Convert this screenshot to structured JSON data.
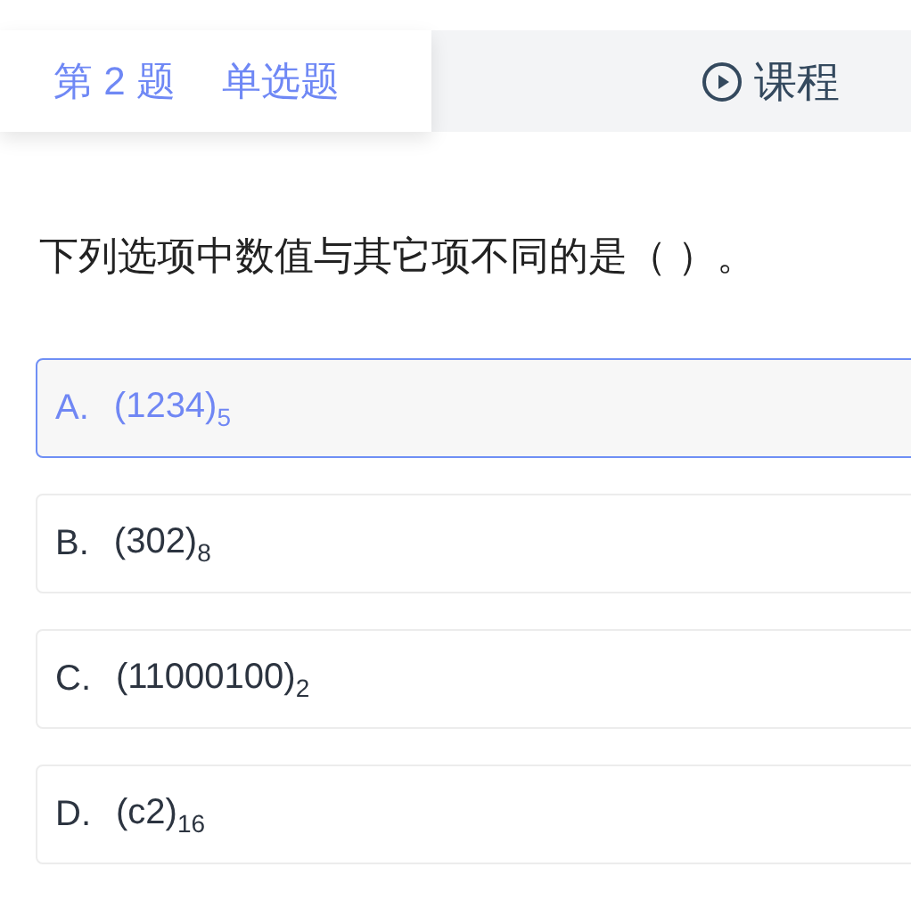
{
  "header": {
    "question_number": "第 2 题",
    "question_type": "单选题",
    "course_link": "课程"
  },
  "question": "下列选项中数值与其它项不同的是（  ）。",
  "options": [
    {
      "letter": "A.",
      "text": "(1234)$_{5}$",
      "selected": true
    },
    {
      "letter": "B.",
      "text": "(302)$_{8}$",
      "selected": false
    },
    {
      "letter": "C.",
      "text": "(11000100)$_{2}$",
      "selected": false
    },
    {
      "letter": "D.",
      "text": "(c2)$_{16}$",
      "selected": false
    }
  ]
}
